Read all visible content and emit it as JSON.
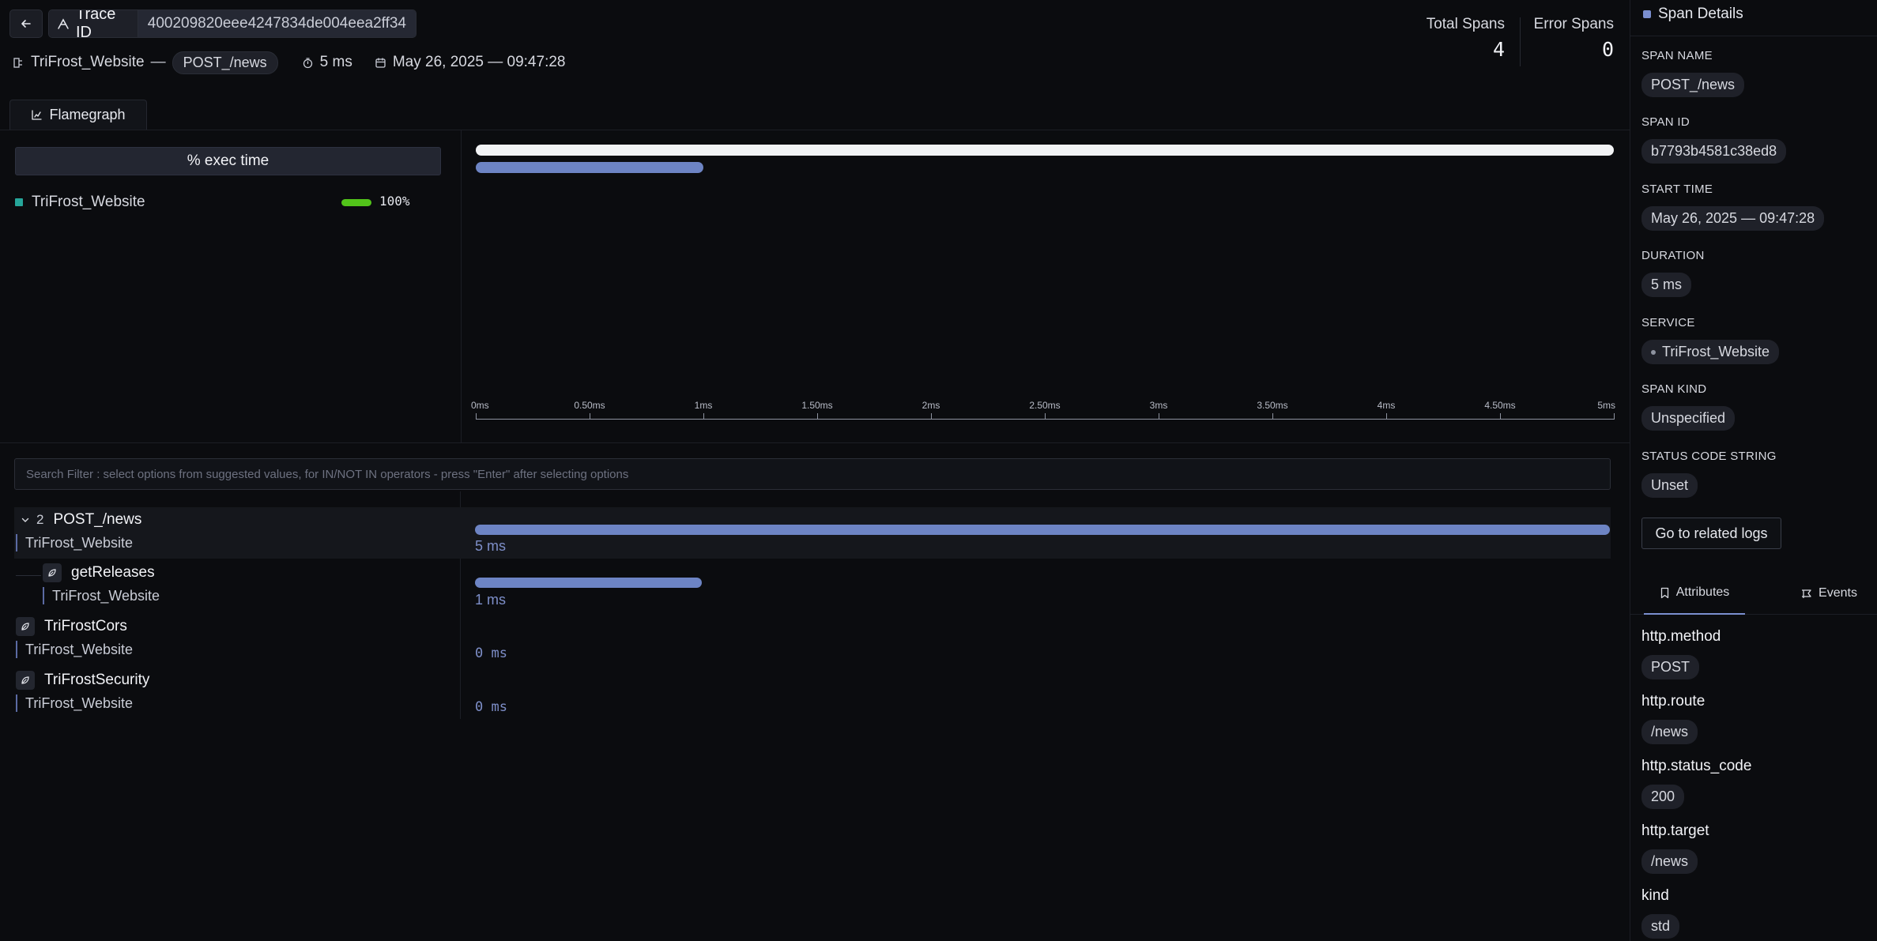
{
  "header": {
    "back_icon": "arrow-left-icon",
    "trace_label": "Trace ID",
    "trace_id": "400209820eee4247834de004eea2ff34",
    "service": "TriFrost_Website",
    "separator": "—",
    "root_span": "POST_/news",
    "duration": "5 ms",
    "timestamp": "May 26, 2025 — 09:47:28",
    "stats": {
      "total_label": "Total Spans",
      "total_value": "4",
      "error_label": "Error Spans",
      "error_value": "0"
    }
  },
  "tabs": {
    "flamegraph": "Flamegraph"
  },
  "exec_panel": {
    "header": "% exec time",
    "service": "TriFrost_Website",
    "service_color": "#26a69a",
    "percent_text": "100%",
    "percent_value": 100
  },
  "timeline": {
    "ticks": [
      "0ms",
      "0.50ms",
      "1ms",
      "1.50ms",
      "2ms",
      "2.50ms",
      "3ms",
      "3.50ms",
      "4ms",
      "4.50ms",
      "5ms"
    ],
    "flame_bars": [
      {
        "start_ms": 0,
        "duration_ms": 5,
        "color": "#f2f3f5"
      },
      {
        "start_ms": 0,
        "duration_ms": 1,
        "color": "#6d84c4"
      }
    ]
  },
  "search": {
    "placeholder": "Search Filter : select options from suggested values, for IN/NOT IN operators - press \"Enter\" after selecting options",
    "value": ""
  },
  "spans": [
    {
      "name": "POST_/news",
      "service": "TriFrost_Website",
      "duration": "5 ms",
      "duration_ms": 5,
      "children_count": "2",
      "expanded": true
    },
    {
      "name": "getReleases",
      "service": "TriFrost_Website",
      "duration": "1 ms",
      "duration_ms": 1
    },
    {
      "name": "TriFrostCors",
      "service": "TriFrost_Website",
      "duration": "0 ms",
      "duration_ms": 0
    },
    {
      "name": "TriFrostSecurity",
      "service": "TriFrost_Website",
      "duration": "0 ms",
      "duration_ms": 0
    }
  ],
  "details": {
    "title": "Span Details",
    "fields": [
      {
        "label": "SPAN NAME",
        "value": "POST_/news"
      },
      {
        "label": "SPAN ID",
        "value": "b7793b4581c38ed8"
      },
      {
        "label": "START TIME",
        "value": "May 26, 2025 — 09:47:28"
      },
      {
        "label": "DURATION",
        "value": "5 ms"
      },
      {
        "label": "SERVICE",
        "value": "TriFrost_Website"
      },
      {
        "label": "SPAN KIND",
        "value": "Unspecified"
      },
      {
        "label": "STATUS CODE STRING",
        "value": "Unset"
      }
    ],
    "related_logs": "Go to related logs",
    "tab_attributes": "Attributes",
    "tab_events": "Events",
    "attributes": [
      {
        "key": "http.method",
        "value": "POST"
      },
      {
        "key": "http.route",
        "value": "/news"
      },
      {
        "key": "http.status_code",
        "value": "200"
      },
      {
        "key": "http.target",
        "value": "/news"
      },
      {
        "key": "kind",
        "value": "std"
      }
    ]
  }
}
